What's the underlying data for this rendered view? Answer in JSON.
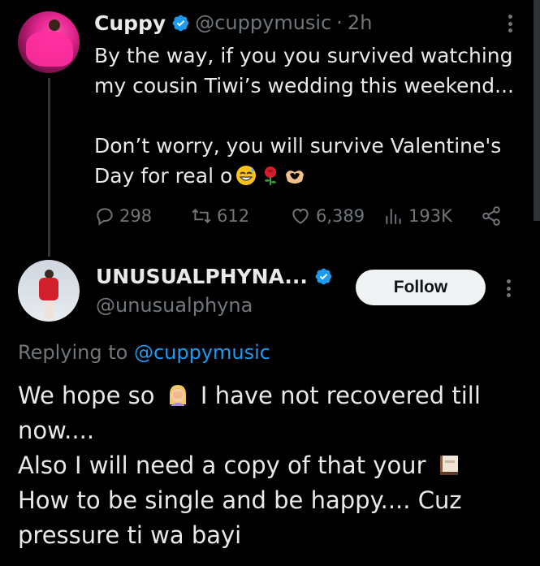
{
  "tweet1": {
    "author_name": "Cuppy",
    "handle": "@cuppymusic",
    "separator": "·",
    "time": "2h",
    "lines": [
      "By the way, if you you survived watching",
      "my cousin Tiwi’s wedding this weekend...",
      "Don’t worry, you will survive Valentine's",
      "Day for real o"
    ],
    "emojis": [
      "sweat-smile-emoji",
      "rose-emoji",
      "heart-hands-emoji"
    ],
    "metrics": {
      "replies": "298",
      "reposts": "612",
      "likes": "6,389",
      "views": "193K"
    }
  },
  "tweet2": {
    "author_name": "UNUSUALPHYNA...",
    "handle": "@unusualphyna",
    "follow_label": "Follow",
    "replying_prefix": "Replying to",
    "replying_mention": "@cuppymusic",
    "line1_start": "We hope so",
    "line1_end": "I have not recovered till",
    "line2": "now....",
    "line3": "Also I will need a copy of that your",
    "line4": "How to be single and be happy.... Cuz",
    "line5": "pressure ti wa bayi",
    "emojis": [
      "facepalm-woman-emoji",
      "book-emoji"
    ]
  },
  "colors": {
    "background": "#000000",
    "text": "#e7e9ea",
    "secondary_text": "#71767b",
    "accent": "#1d9bf0",
    "verified": "#1d9bf0",
    "follow_button": "#eff3f4"
  }
}
